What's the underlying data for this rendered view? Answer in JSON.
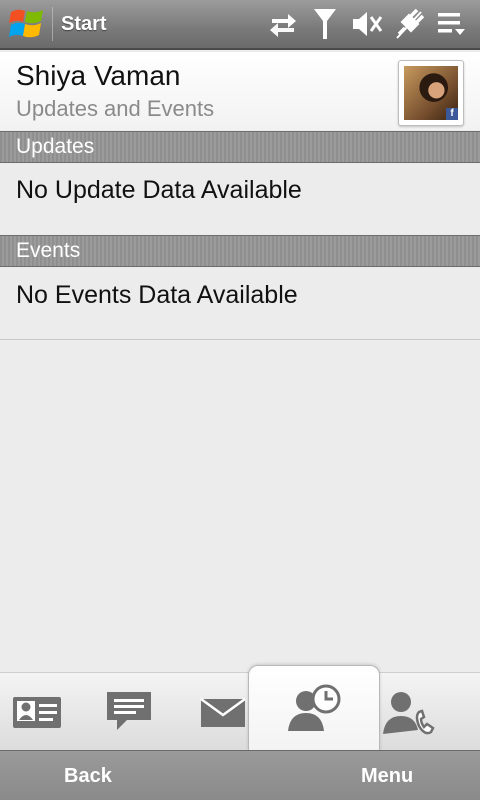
{
  "statusbar": {
    "title": "Start",
    "icons": [
      "data-connection-icon",
      "signal-icon",
      "volume-muted-icon",
      "power-plug-icon",
      "menu-list-icon"
    ]
  },
  "contact": {
    "name": "Shiya Vaman",
    "subtitle": "Updates and Events",
    "badge": "f"
  },
  "sections": {
    "updates": {
      "header": "Updates",
      "body": "No Update Data Available"
    },
    "events": {
      "header": "Events",
      "body": "No Events Data Available"
    }
  },
  "tabs": [
    {
      "id": "contact-card",
      "icon": "contact-card-icon"
    },
    {
      "id": "messages",
      "icon": "message-bubble-icon"
    },
    {
      "id": "email",
      "icon": "envelope-icon"
    },
    {
      "id": "updates-events",
      "icon": "person-clock-icon",
      "selected": true
    },
    {
      "id": "call-history",
      "icon": "person-phone-icon"
    }
  ],
  "softkeys": {
    "left": "Back",
    "right": "Menu"
  },
  "colors": {
    "statusbar": "#7a7a7a",
    "section_header": "#959595",
    "background": "#ececec",
    "fb_blue": "#3b5998"
  }
}
